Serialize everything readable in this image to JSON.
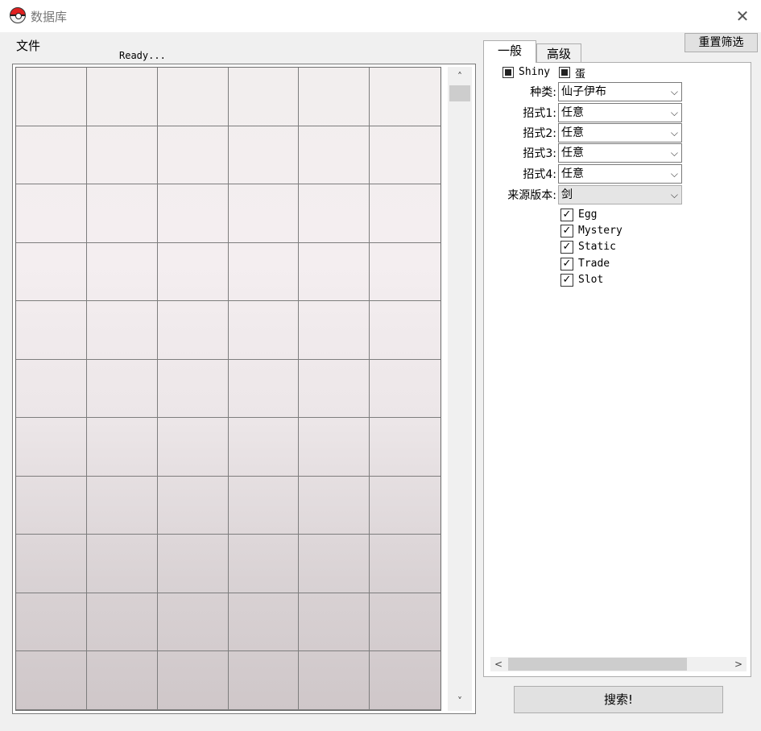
{
  "window": {
    "title": "数据库",
    "close_glyph": "✕"
  },
  "menu": {
    "file": "文件"
  },
  "status": "Ready...",
  "grid": {
    "rows": 11,
    "cols": 6
  },
  "scroll": {
    "up": "˄",
    "down": "˅",
    "left": "<",
    "right": ">"
  },
  "reset_button": "重置筛选",
  "tabs": {
    "general": "一般",
    "advanced": "高级"
  },
  "filters": {
    "shiny": "Shiny",
    "egg_toggle": "蛋",
    "species_label": "种类:",
    "species_value": "仙子伊布",
    "move1_label": "招式1:",
    "move1_value": "任意",
    "move2_label": "招式2:",
    "move2_value": "任意",
    "move3_label": "招式3:",
    "move3_value": "任意",
    "move4_label": "招式4:",
    "move4_value": "任意",
    "version_label": "来源版本:",
    "version_value": "剑",
    "chevron": "⌵"
  },
  "sources": [
    {
      "label": "Egg",
      "checked": true
    },
    {
      "label": "Mystery",
      "checked": true
    },
    {
      "label": "Static",
      "checked": true
    },
    {
      "label": "Trade",
      "checked": true
    },
    {
      "label": "Slot",
      "checked": true
    }
  ],
  "check_glyph": "✓",
  "search_button": "搜索!"
}
